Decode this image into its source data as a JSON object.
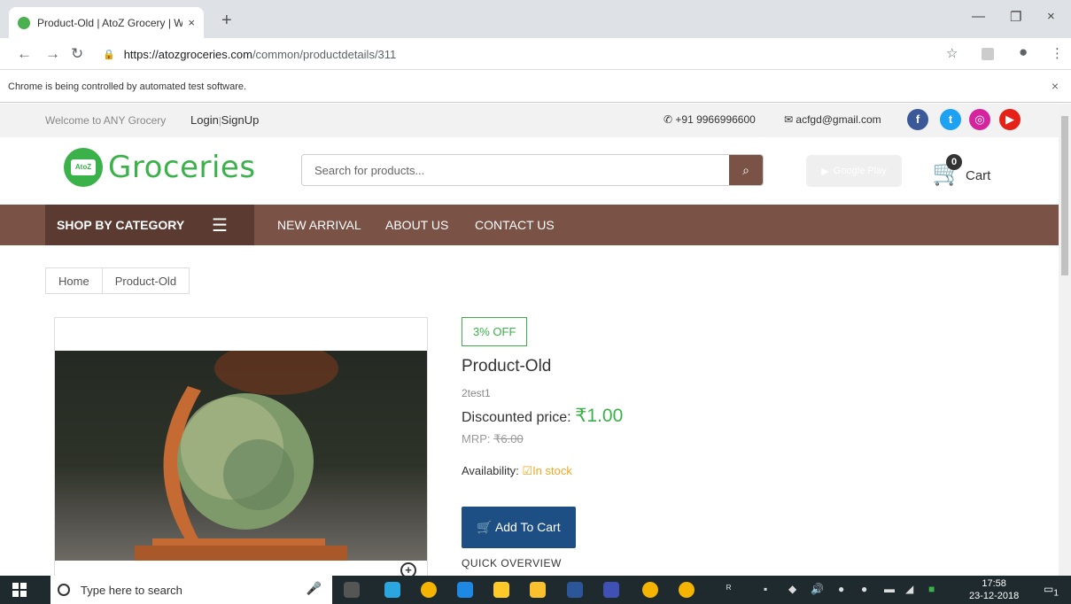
{
  "browser": {
    "tab_title": "Product-Old | AtoZ Grocery | Wh",
    "tab_close": "×",
    "new_tab": "+",
    "url_host": "https://atozgroceries.com",
    "url_path": "/common/productdetails/311",
    "infobar_text": "Chrome is being controlled by automated test software.",
    "infobar_close": "×",
    "minimize": "—",
    "restore": "❐",
    "close": "×"
  },
  "header": {
    "welcome": "Welcome to ANY Grocery",
    "login": "Login",
    "separator": "|",
    "signup": "SignUp",
    "phone": "+91 9966996600",
    "email": "acfgd@gmail.com"
  },
  "brand": {
    "logo_badge": "AtoZ",
    "logo_text": "Groceries",
    "accent": "#3bb14a"
  },
  "search": {
    "placeholder": "Search for products..."
  },
  "google_play": "Google Play",
  "cart": {
    "count": "0",
    "label": "Cart"
  },
  "nav": {
    "shop_by_category": "SHOP BY CATEGORY",
    "links": [
      "NEW ARRIVAL",
      "ABOUT US",
      "CONTACT US"
    ],
    "bar_color": "#7a5246"
  },
  "breadcrumb": [
    "Home",
    "Product-Old"
  ],
  "product": {
    "badge": "3% OFF",
    "name": "Product-Old",
    "subtitle": "2test1",
    "discount_label": "Discounted price: ",
    "discount_price": "₹1.00",
    "mrp_label": "MRP: ",
    "mrp_price": "₹6.00",
    "availability_label": "Availability: ",
    "availability_value": "In stock",
    "add_to_cart": "Add To Cart",
    "quick_overview": "QUICK OVERVIEW"
  },
  "taskbar": {
    "search_placeholder": "Type here to search",
    "time": "17:58",
    "date": "23-12-2018",
    "notification_count": "1"
  }
}
